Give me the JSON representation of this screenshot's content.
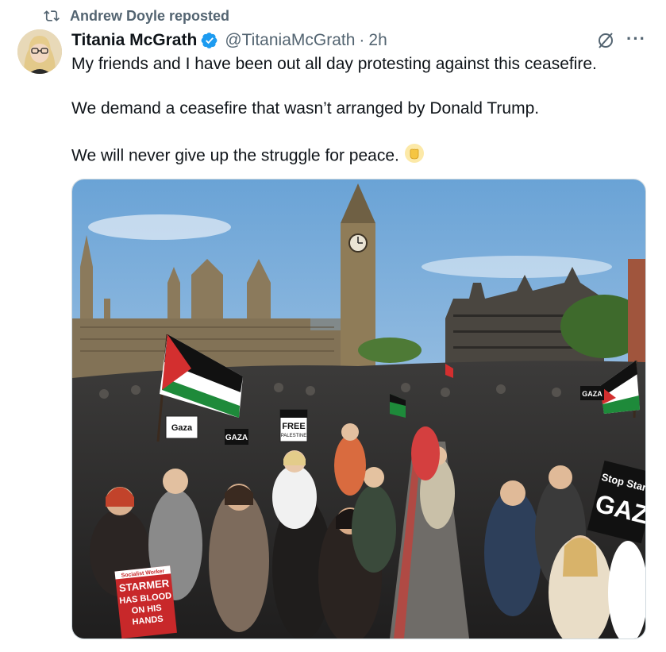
{
  "repost": {
    "label": "Andrew Doyle reposted",
    "icon": "repost-icon"
  },
  "author": {
    "display_name": "Titania McGrath",
    "verified": true,
    "handle": "@TitaniaMcGrath",
    "separator": "·",
    "time": "2h"
  },
  "tweet": {
    "line1": "My friends and I have been out all day protesting against this ceasefire.",
    "line2": "We demand a ceasefire that wasn’t arranged by Donald Trump.",
    "line3": "We will never give up the struggle for peace."
  },
  "media": {
    "description_icon": "protest-photo",
    "signs": {
      "gaza_left": "Gaza",
      "gaza_mid": "GAZA",
      "free_palestine_1": "FREE",
      "free_palestine_2": "PALESTINE",
      "stop_starving": "Stop Starv",
      "gaza_right": "GAZ",
      "gaza_far": "GAZA",
      "socialist_worker": "Socialist Worker",
      "starmer_1": "STARMER",
      "starmer_2": "HAS BLOOD",
      "starmer_3": "ON HIS",
      "starmer_4": "HANDS"
    }
  },
  "colors": {
    "text_primary": "#0f1419",
    "text_secondary": "#536471",
    "verified_blue": "#1d9bf0",
    "border": "#cfd9de"
  }
}
